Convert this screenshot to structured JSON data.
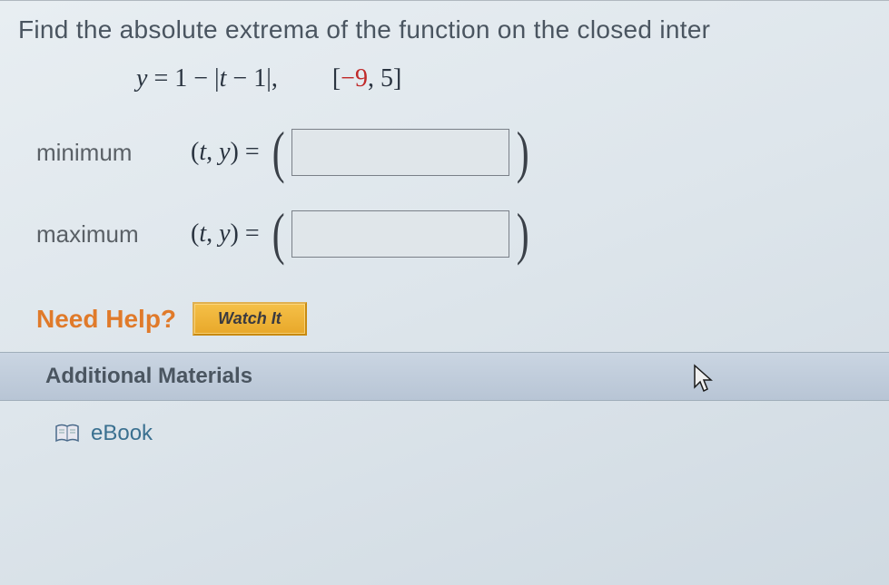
{
  "prompt": "Find the absolute extrema of the function on the closed inter",
  "equation": {
    "lhs_var": "y",
    "eq": " = ",
    "rhs_1": "1 − |",
    "rhs_t": "t",
    "rhs_2": " − 1|,",
    "interval_open": "[",
    "interval_neg": "−9",
    "interval_rest": ", 5]"
  },
  "rows": {
    "min": {
      "label": "minimum",
      "ty_t": "t",
      "ty_sep": ", ",
      "ty_y": "y",
      "ty_eq": " ="
    },
    "max": {
      "label": "maximum",
      "ty_t": "t",
      "ty_sep": ", ",
      "ty_y": "y",
      "ty_eq": " ="
    }
  },
  "help": {
    "label": "Need Help?",
    "watch": "Watch It"
  },
  "materials": {
    "title": "Additional Materials",
    "ebook": "eBook"
  }
}
